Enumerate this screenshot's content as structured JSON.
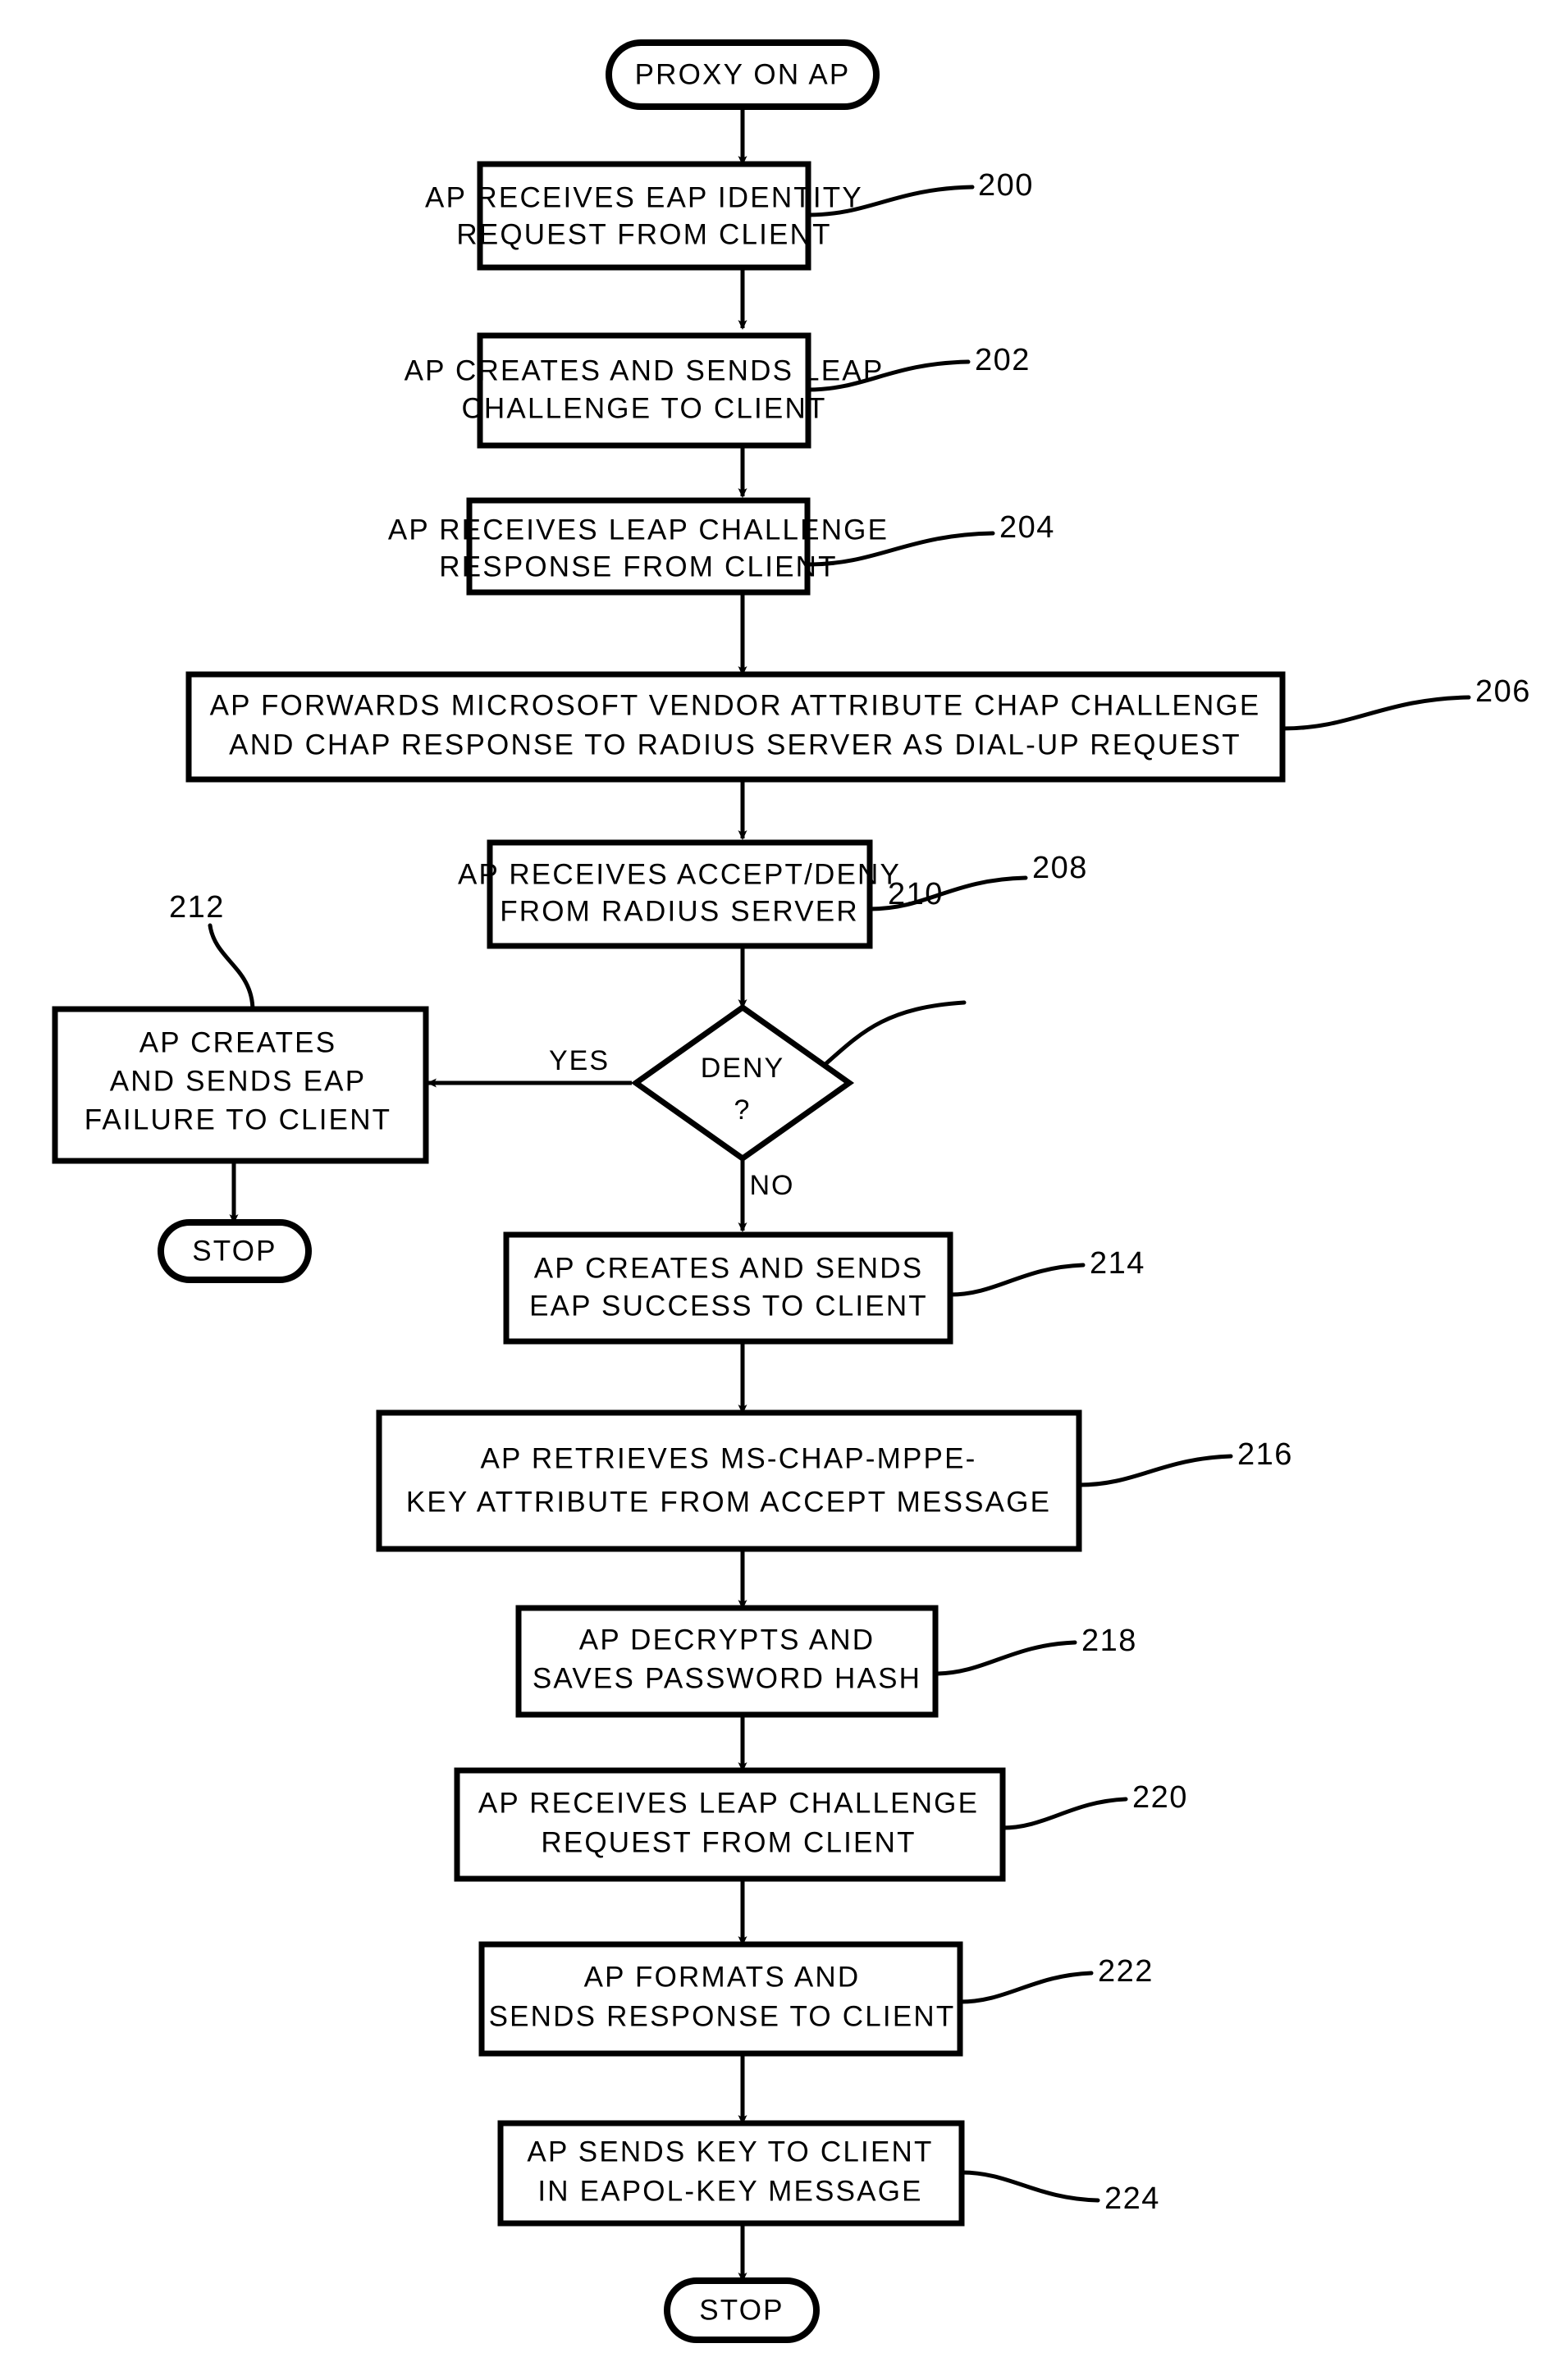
{
  "figure": {
    "title": "PROXY ON AP",
    "type": "flowchart",
    "orientation": "vertical"
  },
  "nodes": [
    {
      "id": "start",
      "kind": "terminator",
      "name": "start-terminator",
      "text": "PROXY ON AP",
      "lines": [
        "PROXY ON AP"
      ],
      "ref": null
    },
    {
      "id": "n200",
      "kind": "process",
      "name": "process-ap-receives-eap-identity-request",
      "lines": [
        "AP RECEIVES EAP IDENTITY",
        "REQUEST FROM CLIENT"
      ],
      "ref": "200"
    },
    {
      "id": "n202",
      "kind": "process",
      "name": "process-ap-creates-sends-leap-challenge",
      "lines": [
        "AP CREATES AND SENDS LEAP",
        "CHALLENGE TO CLIENT"
      ],
      "ref": "202"
    },
    {
      "id": "n204",
      "kind": "process",
      "name": "process-ap-receives-leap-challenge-response",
      "lines": [
        "AP RECEIVES LEAP CHALLENGE",
        "RESPONSE FROM CLIENT"
      ],
      "ref": "204"
    },
    {
      "id": "n206",
      "kind": "process",
      "name": "process-ap-forwards-microsoft-vendor-attribute",
      "lines": [
        "AP FORWARDS MICROSOFT VENDOR ATTRIBUTE CHAP CHALLENGE",
        "AND CHAP RESPONSE TO RADIUS SERVER AS DIAL-UP REQUEST"
      ],
      "ref": "206"
    },
    {
      "id": "n208",
      "kind": "process",
      "name": "process-ap-receives-accept-deny",
      "lines": [
        "AP RECEIVES ACCEPT/DENY",
        "FROM RADIUS SERVER"
      ],
      "ref": "208"
    },
    {
      "id": "n210",
      "kind": "decision",
      "name": "decision-deny",
      "lines": [
        "DENY",
        "?"
      ],
      "ref": "210"
    },
    {
      "id": "n212",
      "kind": "process",
      "name": "process-ap-creates-sends-eap-failure",
      "lines": [
        "AP CREATES",
        "AND SENDS EAP",
        "FAILURE TO CLIENT"
      ],
      "ref": "212"
    },
    {
      "id": "stop-left",
      "kind": "terminator",
      "name": "stop-terminator-failure",
      "lines": [
        "STOP"
      ],
      "ref": null
    },
    {
      "id": "n214",
      "kind": "process",
      "name": "process-ap-creates-sends-eap-success",
      "lines": [
        "AP CREATES AND SENDS",
        "EAP SUCCESS TO CLIENT"
      ],
      "ref": "214"
    },
    {
      "id": "n216",
      "kind": "process",
      "name": "process-ap-retrieves-mppe-key-attribute",
      "lines": [
        "AP RETRIEVES MS-CHAP-MPPE-",
        "KEY ATTRIBUTE FROM ACCEPT MESSAGE"
      ],
      "ref": "216"
    },
    {
      "id": "n218",
      "kind": "process",
      "name": "process-ap-decrypts-saves-password-hash",
      "lines": [
        "AP DECRYPTS AND",
        "SAVES PASSWORD HASH"
      ],
      "ref": "218"
    },
    {
      "id": "n220",
      "kind": "process",
      "name": "process-ap-receives-leap-challenge-request",
      "lines": [
        "AP RECEIVES LEAP CHALLENGE",
        "REQUEST FROM CLIENT"
      ],
      "ref": "220"
    },
    {
      "id": "n222",
      "kind": "process",
      "name": "process-ap-formats-sends-response",
      "lines": [
        "AP FORMATS AND",
        "SENDS RESPONSE TO CLIENT"
      ],
      "ref": "222"
    },
    {
      "id": "n224",
      "kind": "process",
      "name": "process-ap-sends-key-eapol",
      "lines": [
        "AP SENDS KEY TO CLIENT",
        "IN EAPOL-KEY MESSAGE"
      ],
      "ref": "224"
    },
    {
      "id": "stop-bottom",
      "kind": "terminator",
      "name": "stop-terminator-final",
      "lines": [
        "STOP"
      ],
      "ref": null
    }
  ],
  "edge_labels": {
    "yes": "YES",
    "no": "NO"
  },
  "reference_numerals": {
    "r200": "200",
    "r202": "202",
    "r204": "204",
    "r206": "206",
    "r208": "208",
    "r210": "210",
    "r212": "212",
    "r214": "214",
    "r216": "216",
    "r218": "218",
    "r220": "220",
    "r222": "222",
    "r224": "224"
  },
  "colors": {
    "stroke": "#000000",
    "fill": "#ffffff",
    "background": "#ffffff"
  }
}
